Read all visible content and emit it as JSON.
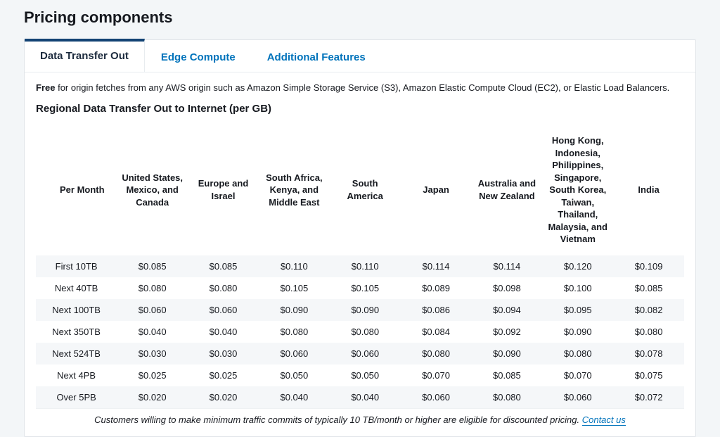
{
  "section_title": "Pricing components",
  "tabs": [
    {
      "label": "Data Transfer Out",
      "active": true
    },
    {
      "label": "Edge Compute",
      "active": false
    },
    {
      "label": "Additional Features",
      "active": false
    }
  ],
  "free_line_bold": "Free",
  "free_line_rest": " for origin fetches from any AWS origin such as Amazon Simple Storage Service (S3), Amazon Elastic Compute Cloud (EC2), or Elastic Load Balancers.",
  "sub_title": "Regional Data Transfer Out to Internet (per GB)",
  "headers": [
    "Per Month",
    "United States, Mexico, and Canada",
    "Europe and Israel",
    "South Africa, Kenya, and Middle East",
    "South America",
    "Japan",
    "Australia and New Zealand",
    "Hong Kong, Indonesia, Philippines, Singapore, South Korea, Taiwan, Thailand, Malaysia, and Vietnam",
    "India"
  ],
  "rows": [
    {
      "tier": "First 10TB",
      "v": [
        "$0.085",
        "$0.085",
        "$0.110",
        "$0.110",
        "$0.114",
        "$0.114",
        "$0.120",
        "$0.109"
      ]
    },
    {
      "tier": "Next 40TB",
      "v": [
        "$0.080",
        "$0.080",
        "$0.105",
        "$0.105",
        "$0.089",
        "$0.098",
        "$0.100",
        "$0.085"
      ]
    },
    {
      "tier": "Next 100TB",
      "v": [
        "$0.060",
        "$0.060",
        "$0.090",
        "$0.090",
        "$0.086",
        "$0.094",
        "$0.095",
        "$0.082"
      ]
    },
    {
      "tier": "Next 350TB",
      "v": [
        "$0.040",
        "$0.040",
        "$0.080",
        "$0.080",
        "$0.084",
        "$0.092",
        "$0.090",
        "$0.080"
      ]
    },
    {
      "tier": "Next 524TB",
      "v": [
        "$0.030",
        "$0.030",
        "$0.060",
        "$0.060",
        "$0.080",
        "$0.090",
        "$0.080",
        "$0.078"
      ]
    },
    {
      "tier": "Next 4PB",
      "v": [
        "$0.025",
        "$0.025",
        "$0.050",
        "$0.050",
        "$0.070",
        "$0.085",
        "$0.070",
        "$0.075"
      ]
    },
    {
      "tier": "Over 5PB",
      "v": [
        "$0.020",
        "$0.020",
        "$0.040",
        "$0.040",
        "$0.060",
        "$0.080",
        "$0.060",
        "$0.072"
      ]
    }
  ],
  "footnote_text": "Customers willing to make minimum traffic commits of typically 10 TB/month or higher are eligible for discounted pricing. ",
  "footnote_link": "Contact us",
  "chart_data": {
    "type": "table",
    "title": "Regional Data Transfer Out to Internet (per GB)",
    "columns": [
      "Per Month",
      "United States, Mexico, and Canada",
      "Europe and Israel",
      "South Africa, Kenya, and Middle East",
      "South America",
      "Japan",
      "Australia and New Zealand",
      "Hong Kong, Indonesia, Philippines, Singapore, South Korea, Taiwan, Thailand, Malaysia, and Vietnam",
      "India"
    ],
    "rows": [
      [
        "First 10TB",
        0.085,
        0.085,
        0.11,
        0.11,
        0.114,
        0.114,
        0.12,
        0.109
      ],
      [
        "Next 40TB",
        0.08,
        0.08,
        0.105,
        0.105,
        0.089,
        0.098,
        0.1,
        0.085
      ],
      [
        "Next 100TB",
        0.06,
        0.06,
        0.09,
        0.09,
        0.086,
        0.094,
        0.095,
        0.082
      ],
      [
        "Next 350TB",
        0.04,
        0.04,
        0.08,
        0.08,
        0.084,
        0.092,
        0.09,
        0.08
      ],
      [
        "Next 524TB",
        0.03,
        0.03,
        0.06,
        0.06,
        0.08,
        0.09,
        0.08,
        0.078
      ],
      [
        "Next 4PB",
        0.025,
        0.025,
        0.05,
        0.05,
        0.07,
        0.085,
        0.07,
        0.075
      ],
      [
        "Over 5PB",
        0.02,
        0.02,
        0.04,
        0.04,
        0.06,
        0.08,
        0.06,
        0.072
      ]
    ],
    "unit": "USD per GB"
  }
}
